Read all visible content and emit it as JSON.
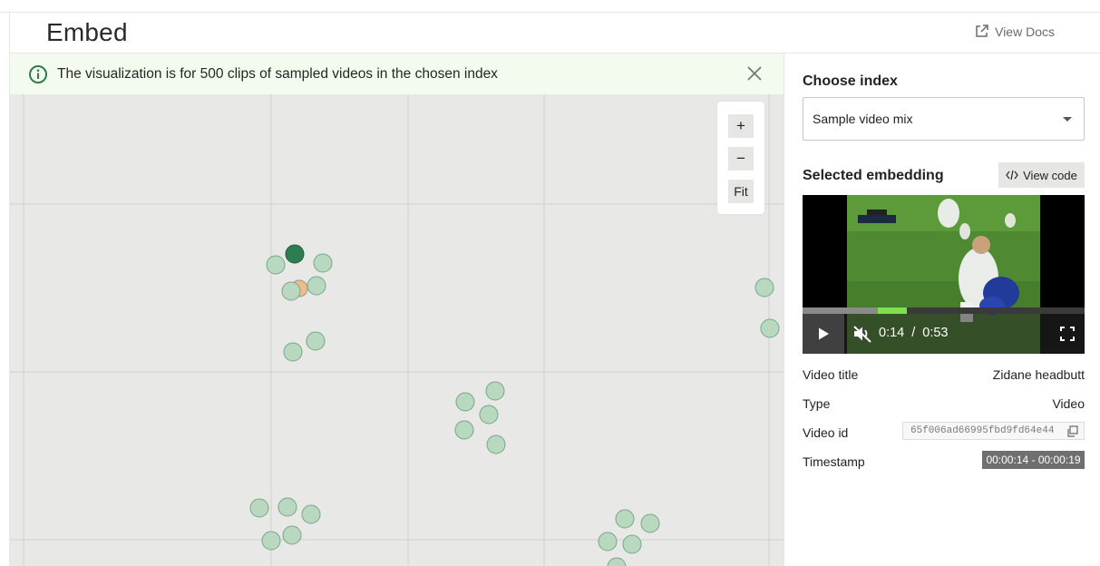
{
  "header": {
    "title": "Embed",
    "docs_label": "View Docs"
  },
  "banner": {
    "text": "The visualization is for 500 clips of sampled videos in the chosen index"
  },
  "zoom": {
    "plus": "+",
    "minus": "−",
    "fit": "Fit"
  },
  "plot": {
    "background": "#e8e8e6",
    "point_fill": "#b8d8c0",
    "point_stroke": "#7aa489",
    "selected_fill": "#2e7d50",
    "highlight_fill": "#f6b98a"
  },
  "sidebar": {
    "choose_index_label": "Choose index",
    "index_selected": "Sample video mix",
    "selected_embedding_label": "Selected embedding",
    "view_code_label": "View code",
    "video": {
      "current_time": "0:14",
      "separator": "/",
      "duration": "0:53",
      "progress_fraction": 0.264
    },
    "meta": {
      "title_key": "Video title",
      "title_value": "Zidane headbutt",
      "type_key": "Type",
      "type_value": "Video",
      "id_key": "Video id",
      "id_value": "65f006ad66995fbd9fd64e44",
      "timestamp_key": "Timestamp",
      "timestamp_value": "00:00:14 - 00:00:19"
    }
  }
}
